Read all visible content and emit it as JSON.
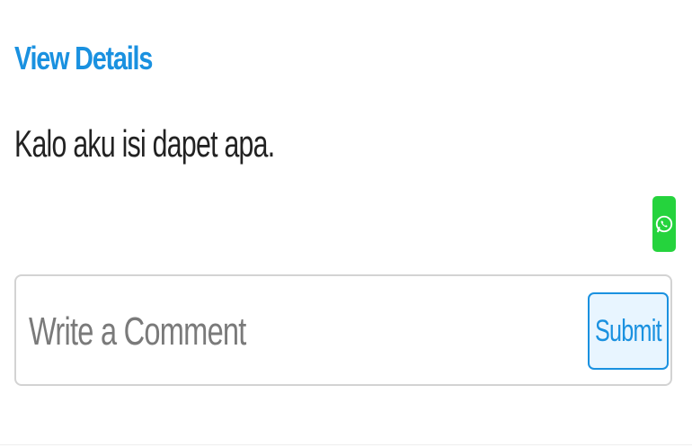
{
  "post": {
    "view_details_label": "View Details",
    "text": "Kalo aku isi dapet apa."
  },
  "share": {
    "icon": "whatsapp-icon",
    "color": "#25d33d"
  },
  "comment": {
    "placeholder": "Write a Comment",
    "value": "",
    "submit_label": "Submit"
  },
  "colors": {
    "accent": "#1a91e0",
    "submit_bg": "#e8f5ff",
    "text": "#222222",
    "border": "#d3d3d3"
  }
}
